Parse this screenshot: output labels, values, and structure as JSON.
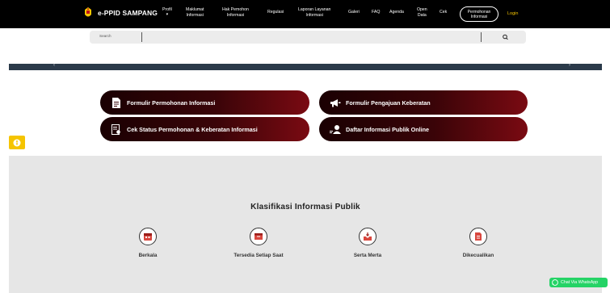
{
  "header": {
    "brand": "e-PPID SAMPANG",
    "nav": [
      {
        "label": "Profil",
        "caret": "▾"
      },
      {
        "label": "Maklumat\nInformasi"
      },
      {
        "label": "Hak Pemohon\nInformasi"
      },
      {
        "label": "Regulasi"
      },
      {
        "label": "Laporan Layanan\nInformasi"
      },
      {
        "label": "Galeri"
      },
      {
        "label": "FAQ"
      },
      {
        "label": "Agenda"
      },
      {
        "label": "Open\nData"
      },
      {
        "label": "Cek"
      }
    ],
    "cta": "Permohonan\nInformasi",
    "login": "Login"
  },
  "search": {
    "placeholder": "Search"
  },
  "slider": {
    "prev": "‹",
    "next": "›"
  },
  "buttons": [
    {
      "label": "Formulir Permohonan Informasi",
      "icon": "document-icon"
    },
    {
      "label": "Formulir Pengajuan Keberatan",
      "icon": "megaphone-icon"
    },
    {
      "label": "Cek Status Permohonan & Keberatan Informasi",
      "icon": "status-check-icon"
    },
    {
      "label": "Daftar Informasi Publik Online",
      "icon": "user-search-icon"
    }
  ],
  "klasifikasi": {
    "title": "Klasifikasi Informasi Publik",
    "items": [
      {
        "label": "Berkala",
        "icon": "calendar-icon"
      },
      {
        "label": "Tersedia Setiap Saat",
        "icon": "box-icon"
      },
      {
        "label": "Serta Merta",
        "icon": "inbox-icon"
      },
      {
        "label": "Dikecualikan",
        "icon": "file-icon"
      }
    ]
  },
  "whatsapp": {
    "label": "Chat Via WhatsApp"
  },
  "colors": {
    "topbar": "#000000",
    "accent_yellow": "#f5c400",
    "pill_dark": "#1a0002",
    "pill_red": "#7a0a12",
    "section_bg": "#e6e6e6",
    "whatsapp": "#25d366"
  }
}
